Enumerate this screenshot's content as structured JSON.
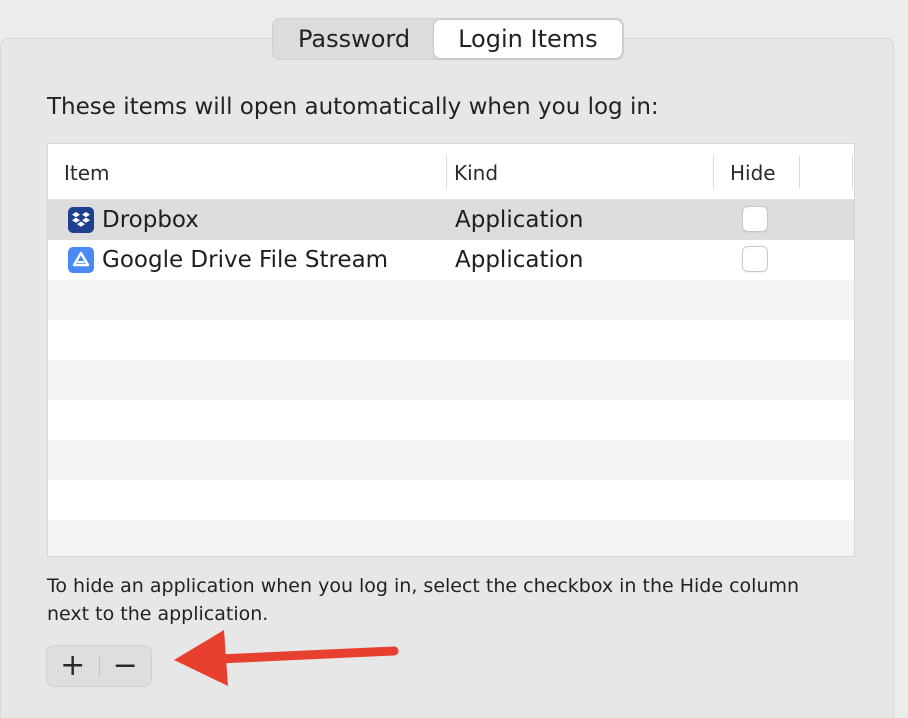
{
  "tabs": [
    {
      "label": "Password",
      "active": false
    },
    {
      "label": "Login Items",
      "active": true
    }
  ],
  "intro_text": "These items will open automatically when you log in:",
  "table": {
    "columns": {
      "item": "Item",
      "kind": "Kind",
      "hide": "Hide"
    },
    "rows": [
      {
        "name": "Dropbox",
        "kind": "Application",
        "hide": false,
        "icon": "dropbox-icon",
        "selected": true
      },
      {
        "name": "Google Drive File Stream",
        "kind": "Application",
        "hide": false,
        "icon": "google-drive-icon",
        "selected": false
      }
    ]
  },
  "note": "To hide an application when you log in, select the checkbox in the Hide column next to the application.",
  "controls": {
    "add_label": "+",
    "remove_label": "−"
  },
  "colors": {
    "dropbox": "#1f3f8f",
    "google_drive": "#4a8af4",
    "arrow": "#e8402f"
  }
}
